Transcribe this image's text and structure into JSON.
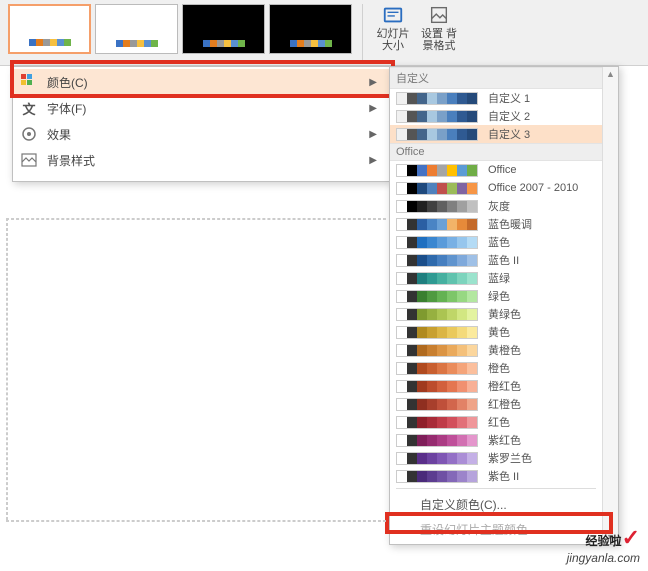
{
  "ribbon": {
    "slide_size_label": "幻灯片\n大小",
    "bg_format_label": "设置\n背景格式"
  },
  "thumb_palettes": [
    [
      "#3a72c4",
      "#e37d1e",
      "#999999",
      "#f6c040",
      "#5a90d0",
      "#6fb44a"
    ],
    [
      "#3a72c4",
      "#e37d1e",
      "#999999",
      "#f6c040",
      "#5a90d0",
      "#6fb44a"
    ],
    [
      "#3a72c4",
      "#e37d1e",
      "#999999",
      "#f6c040",
      "#5a90d0",
      "#6fb44a"
    ],
    [
      "#3a72c4",
      "#e37d1e",
      "#999999",
      "#f6c040",
      "#5a90d0",
      "#6fb44a"
    ]
  ],
  "menu": {
    "colors": "颜色(C)",
    "fonts": "字体(F)",
    "effects": "效果",
    "bg_style": "背景样式"
  },
  "sub": {
    "custom_hdr": "自定义",
    "office_hdr": "Office",
    "customize": "自定义颜色(C)...",
    "reset": "重设幻灯片主题颜色"
  },
  "custom_themes": [
    {
      "name": "自定义 1",
      "colors": [
        "#f1f1f1",
        "#555",
        "#43658b",
        "#a8c8e0",
        "#7aa0c8",
        "#4a7fbd",
        "#2f5a92",
        "#254a7a"
      ]
    },
    {
      "name": "自定义 2",
      "colors": [
        "#f1f1f1",
        "#555",
        "#43658b",
        "#a8c8e0",
        "#7aa0c8",
        "#4a7fbd",
        "#2f5a92",
        "#254a7a"
      ]
    },
    {
      "name": "自定义 3",
      "colors": [
        "#f1f1f1",
        "#555",
        "#43658b",
        "#a8c8e0",
        "#7aa0c8",
        "#4a7fbd",
        "#2f5a92",
        "#254a7a"
      ]
    }
  ],
  "office_themes": [
    {
      "name": "Office",
      "colors": [
        "#fff",
        "#000",
        "#4472c4",
        "#ed7d31",
        "#a5a5a5",
        "#ffc000",
        "#5b9bd5",
        "#70ad47"
      ]
    },
    {
      "name": "Office 2007 - 2010",
      "colors": [
        "#fff",
        "#000",
        "#1f497d",
        "#4f81bd",
        "#c0504d",
        "#9bbb59",
        "#8064a2",
        "#f79646"
      ]
    },
    {
      "name": "灰度",
      "colors": [
        "#fff",
        "#000",
        "#202020",
        "#404040",
        "#606060",
        "#808080",
        "#a0a0a0",
        "#c0c0c0"
      ]
    },
    {
      "name": "蓝色暖调",
      "colors": [
        "#fff",
        "#333",
        "#2b5fa3",
        "#4a84c4",
        "#6aa0d6",
        "#f2b368",
        "#e68a3a",
        "#c46a2a"
      ]
    },
    {
      "name": "蓝色",
      "colors": [
        "#fff",
        "#333",
        "#1f6fc0",
        "#3a86d0",
        "#5a9bda",
        "#78b0e4",
        "#96c6ed",
        "#b4dbf5"
      ]
    },
    {
      "name": "蓝色 II",
      "colors": [
        "#fff",
        "#333",
        "#1b4e8a",
        "#2f6aac",
        "#467fc0",
        "#6094ce",
        "#7fa9db",
        "#9fc0e6"
      ]
    },
    {
      "name": "蓝绿",
      "colors": [
        "#fff",
        "#333",
        "#1f7f7f",
        "#2f9a92",
        "#46b0a0",
        "#60c3ae",
        "#7dd4bd",
        "#9be3cd"
      ]
    },
    {
      "name": "绿色",
      "colors": [
        "#fff",
        "#333",
        "#3a7f2f",
        "#4f9a40",
        "#64b252",
        "#7dc668",
        "#97d882",
        "#b3e7a0"
      ]
    },
    {
      "name": "黄绿色",
      "colors": [
        "#fff",
        "#333",
        "#7f9a2f",
        "#96b040",
        "#abc452",
        "#bfd668",
        "#d2e782",
        "#e3f3a0"
      ]
    },
    {
      "name": "黄色",
      "colors": [
        "#fff",
        "#333",
        "#b08a1f",
        "#c8a030",
        "#dbb544",
        "#eac95c",
        "#f4da7a",
        "#fbea9d"
      ]
    },
    {
      "name": "黄橙色",
      "colors": [
        "#fff",
        "#333",
        "#b06a1f",
        "#c87f30",
        "#db9444",
        "#eaaa5c",
        "#f4c07a",
        "#fbd69d"
      ]
    },
    {
      "name": "橙色",
      "colors": [
        "#fff",
        "#333",
        "#b04a1f",
        "#c85f30",
        "#db7544",
        "#ea8c5c",
        "#f4a47a",
        "#fbbf9d"
      ]
    },
    {
      "name": "橙红色",
      "colors": [
        "#fff",
        "#333",
        "#a03a1f",
        "#bc4c2c",
        "#d2603c",
        "#e47650",
        "#f09070",
        "#f8b096"
      ]
    },
    {
      "name": "红橙色",
      "colors": [
        "#fff",
        "#333",
        "#8f2f20",
        "#a83f2c",
        "#bf503a",
        "#d2664c",
        "#e28266",
        "#efa488"
      ]
    },
    {
      "name": "红色",
      "colors": [
        "#fff",
        "#333",
        "#8f1f2a",
        "#a82c38",
        "#bf3c48",
        "#d2505c",
        "#e27078",
        "#ef969a"
      ]
    },
    {
      "name": "紫红色",
      "colors": [
        "#fff",
        "#333",
        "#7f1f5a",
        "#962c70",
        "#ab3c84",
        "#bf509a",
        "#d270b2",
        "#e496cc"
      ]
    },
    {
      "name": "紫罗兰色",
      "colors": [
        "#fff",
        "#333",
        "#5a2f8a",
        "#6c42a0",
        "#7f56b4",
        "#9470c6",
        "#ab8ed6",
        "#c4b0e6"
      ]
    },
    {
      "name": "紫色 II",
      "colors": [
        "#fff",
        "#333",
        "#4a2a7a",
        "#5c3c90",
        "#6f50a4",
        "#8468b8",
        "#9c84ca",
        "#b6a4dc"
      ]
    }
  ],
  "watermark": {
    "line1": "经验啦",
    "line2": "jingyanla.com"
  }
}
